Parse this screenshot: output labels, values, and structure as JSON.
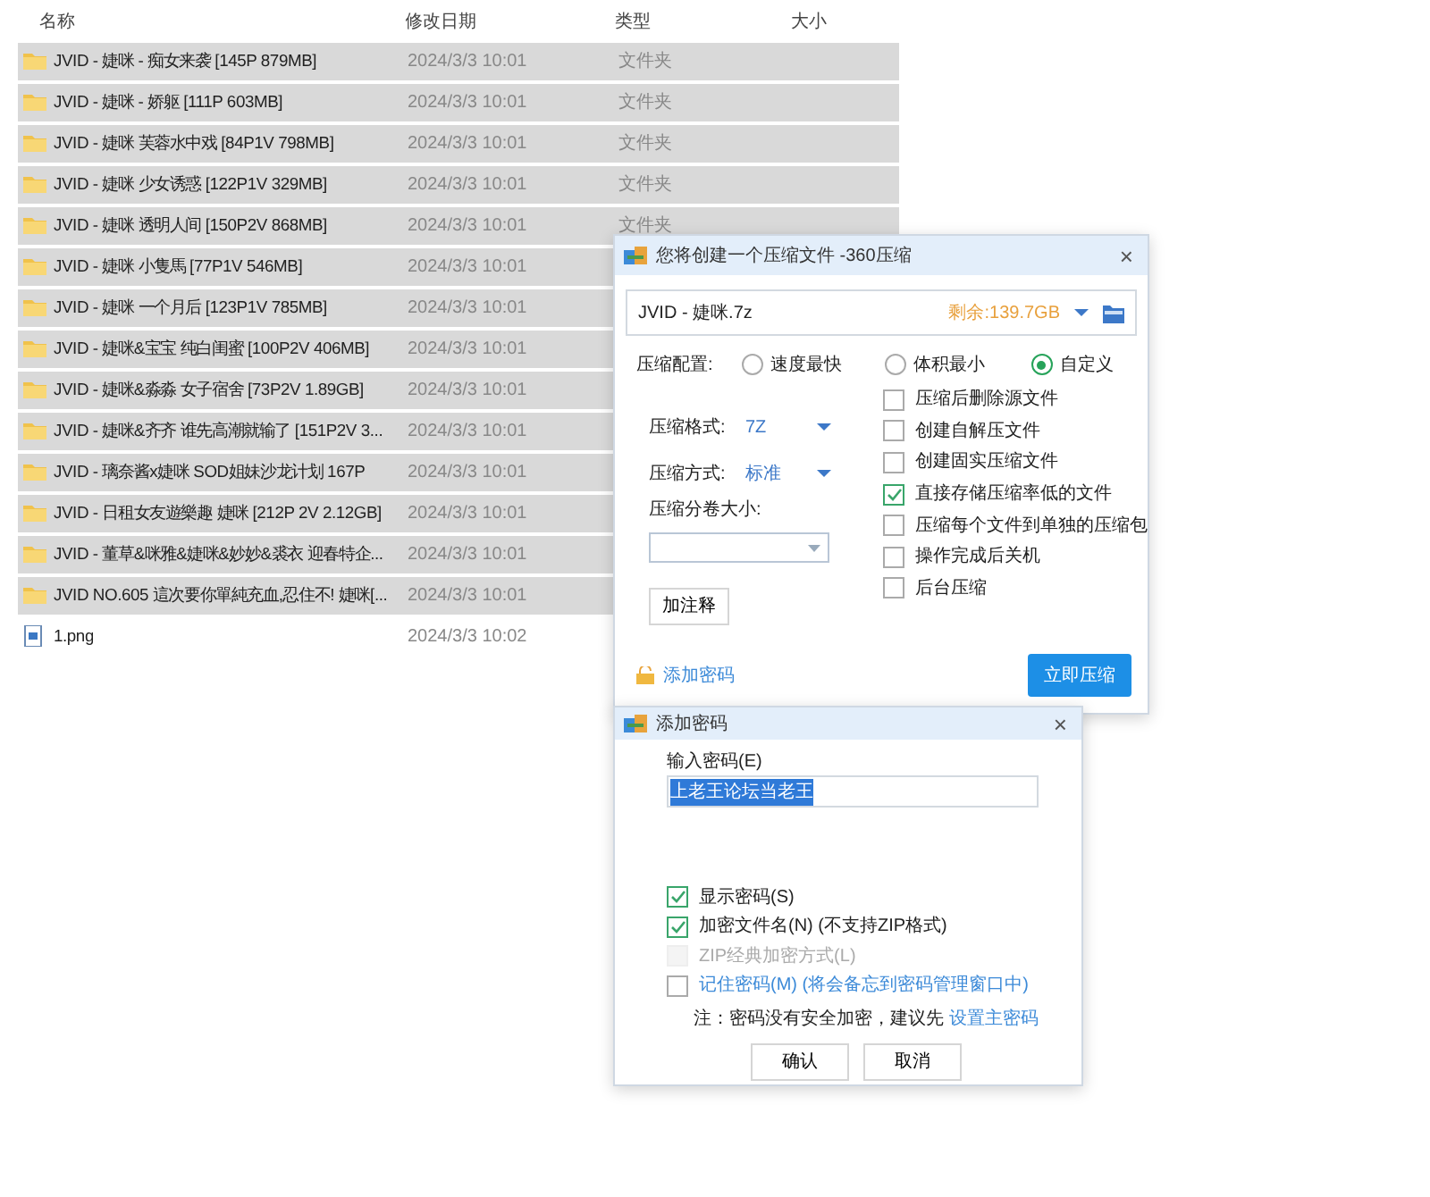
{
  "file_list": {
    "columns": [
      "名称",
      "修改日期",
      "类型",
      "大小"
    ],
    "rows": [
      {
        "kind": "folder",
        "name": "JVID - 婕咪 - 痴女来袭 [145P 879MB]",
        "date": "2024/3/3 10:01",
        "type": "文件夹",
        "selected": true
      },
      {
        "kind": "folder",
        "name": "JVID - 婕咪 - 娇躯 [111P 603MB]",
        "date": "2024/3/3 10:01",
        "type": "文件夹",
        "selected": true
      },
      {
        "kind": "folder",
        "name": "JVID - 婕咪 芙蓉水中戏 [84P1V 798MB]",
        "date": "2024/3/3 10:01",
        "type": "文件夹",
        "selected": true
      },
      {
        "kind": "folder",
        "name": "JVID - 婕咪 少女诱惑 [122P1V 329MB]",
        "date": "2024/3/3 10:01",
        "type": "文件夹",
        "selected": true
      },
      {
        "kind": "folder",
        "name": "JVID - 婕咪 透明人间 [150P2V 868MB]",
        "date": "2024/3/3 10:01",
        "type": "文件夹",
        "selected": true
      },
      {
        "kind": "folder",
        "name": "JVID - 婕咪 小隻馬 [77P1V 546MB]",
        "date": "2024/3/3 10:01",
        "selected": true
      },
      {
        "kind": "folder",
        "name": "JVID - 婕咪 一个月后 [123P1V  785MB]",
        "date": "2024/3/3 10:01",
        "selected": true
      },
      {
        "kind": "folder",
        "name": "JVID - 婕咪&宝宝 纯白闺蜜 [100P2V 406MB]",
        "date": "2024/3/3 10:01",
        "selected": true
      },
      {
        "kind": "folder",
        "name": "JVID - 婕咪&淼淼 女子宿舍 [73P2V 1.89GB]",
        "date": "2024/3/3 10:01",
        "selected": true
      },
      {
        "kind": "folder",
        "name": "JVID - 婕咪&齐齐 谁先高潮就输了 [151P2V 3...",
        "date": "2024/3/3 10:01",
        "selected": true
      },
      {
        "kind": "folder",
        "name": "JVID - 璃奈酱x婕咪 SOD姐妹沙龙计划 167P",
        "date": "2024/3/3 10:01",
        "selected": true
      },
      {
        "kind": "folder",
        "name": "JVID - 日租女友遊樂趣 婕咪 [212P 2V 2.12GB]",
        "date": "2024/3/3 10:01",
        "selected": true
      },
      {
        "kind": "folder",
        "name": "JVID - 董草&咪雅&婕咪&妙妙&裘衣 迎春特企...",
        "date": "2024/3/3 10:01",
        "selected": true
      },
      {
        "kind": "folder",
        "name": "JVID NO.605 這次要你單純充血,忍住不! 婕咪[...",
        "date": "2024/3/3 10:01",
        "selected": true
      },
      {
        "kind": "image",
        "name": "1.png",
        "date": "2024/3/3 10:02",
        "selected": false
      }
    ]
  },
  "compress_dialog": {
    "title": "您将创建一个压缩文件 -360压缩",
    "close": "×",
    "filename": "JVID - 婕咪.7z",
    "free_space": "剩余:139.7GB",
    "config_label": "压缩配置:",
    "presets": [
      {
        "label": "速度最快",
        "selected": false
      },
      {
        "label": "体积最小",
        "selected": false
      },
      {
        "label": "自定义",
        "selected": true
      }
    ],
    "format_label": "压缩格式:",
    "format": "7Z",
    "method_label": "压缩方式:",
    "method": "标准",
    "volume_label": "压缩分卷大小:",
    "comment_button": "加注释",
    "options": [
      {
        "label": "压缩后删除源文件",
        "checked": false
      },
      {
        "label": "创建自解压文件",
        "checked": false
      },
      {
        "label": "创建固实压缩文件",
        "checked": false
      },
      {
        "label": "直接存储压缩率低的文件",
        "checked": true
      },
      {
        "label": "压缩每个文件到单独的压缩包",
        "checked": false
      },
      {
        "label": "操作完成后关机",
        "checked": false
      },
      {
        "label": "后台压缩",
        "checked": false
      }
    ],
    "password_link": "添加密码",
    "compress_button": "立即压缩"
  },
  "password_dialog": {
    "title": "添加密码",
    "close": "×",
    "input_label": "输入密码(E)",
    "password": "上老王论坛当老王",
    "options": [
      {
        "label": "显示密码(S)",
        "checked": true,
        "disabled": false,
        "kind": "plain"
      },
      {
        "label": "加密文件名(N) (不支持ZIP格式)",
        "checked": true,
        "disabled": false,
        "kind": "plain"
      },
      {
        "label": "ZIP经典加密方式(L)",
        "checked": false,
        "disabled": true,
        "kind": "plain"
      },
      {
        "label": "记住密码(M) (将会备忘到密码管理窗口中)",
        "checked": false,
        "disabled": false,
        "kind": "link"
      }
    ],
    "note": "注：密码没有安全加密，建议先",
    "note_link": "设置主密码",
    "ok_button": "确认",
    "cancel_button": "取消"
  }
}
